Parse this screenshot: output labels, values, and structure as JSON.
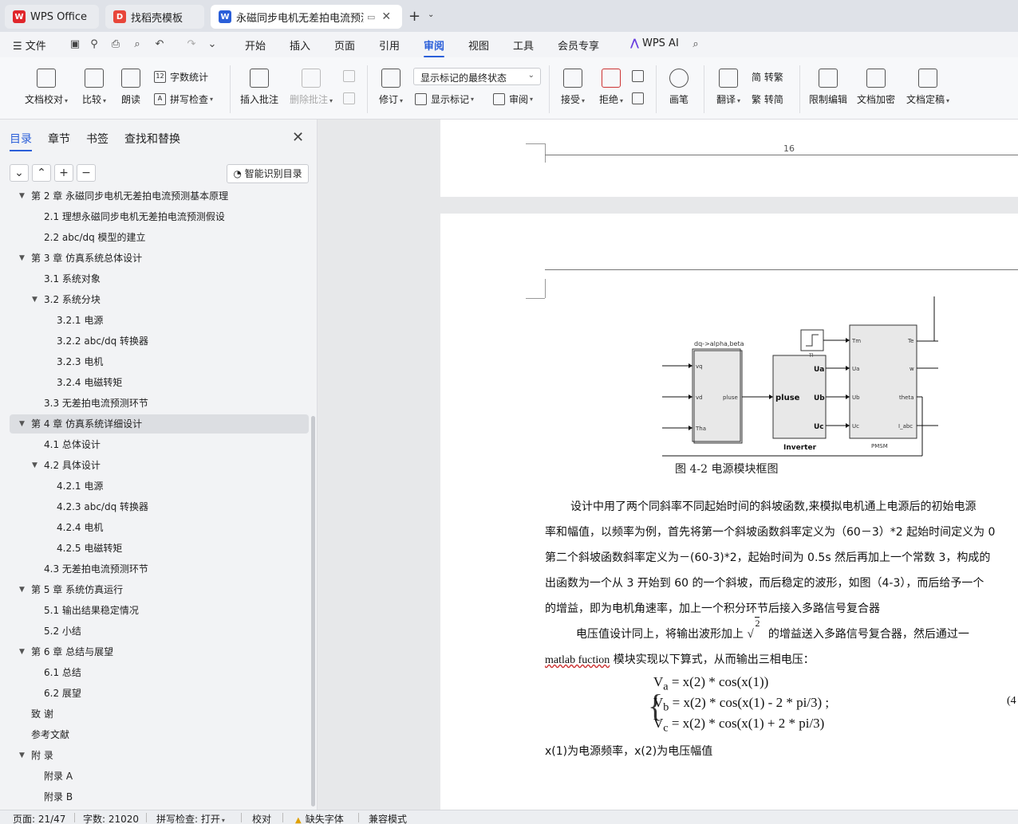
{
  "tabs": [
    {
      "label": "WPS Office",
      "icon": "wps-logo-icon"
    },
    {
      "label": "找稻壳模板",
      "icon": "docer-icon"
    },
    {
      "label": "永磁同步电机无差拍电流预测",
      "icon": "writer-doc-icon"
    }
  ],
  "menu": {
    "file": "文件",
    "items": [
      "开始",
      "插入",
      "页面",
      "引用",
      "审阅",
      "视图",
      "工具",
      "会员专享"
    ],
    "active": "审阅",
    "ai": "WPS AI"
  },
  "ribbon": {
    "doc_check": "文档校对",
    "compare": "比较",
    "read_aloud": "朗读",
    "word_count": "字数统计",
    "spell_check": "拼写检查",
    "insert_comment": "插入批注",
    "delete_comment": "删除批注",
    "track_changes": "修订",
    "markup_mode": "显示标记的最终状态",
    "show_markup": "显示标记",
    "review_pane": "审阅",
    "accept": "接受",
    "reject": "拒绝",
    "pen": "画笔",
    "translate": "翻译",
    "to_traditional": "简 转繁",
    "to_simplified": "繁 转简",
    "restrict_edit": "限制编辑",
    "encrypt": "文档加密",
    "finalize": "文档定稿"
  },
  "sidebar": {
    "tabs": [
      "目录",
      "章节",
      "书签",
      "查找和替换"
    ],
    "active_tab": "目录",
    "smart_toc": "智能识别目录",
    "toc": [
      {
        "text": "第 2 章  永磁同步电机无差拍电流预测基本原理",
        "level": 1,
        "toggle": "▼"
      },
      {
        "text": "2.1 理想永磁同步电机无差拍电流预测假设",
        "level": 2,
        "toggle": ""
      },
      {
        "text": "2.2 abc/dq 模型的建立",
        "level": 2,
        "toggle": ""
      },
      {
        "text": "第 3 章  仿真系统总体设计",
        "level": 1,
        "toggle": "▼"
      },
      {
        "text": "3.1 系统对象",
        "level": 2,
        "toggle": ""
      },
      {
        "text": "3.2 系统分块",
        "level": 2,
        "toggle": "▼"
      },
      {
        "text": "3.2.1 电源",
        "level": 3,
        "toggle": ""
      },
      {
        "text": "3.2.2 abc/dq 转换器",
        "level": 3,
        "toggle": ""
      },
      {
        "text": "3.2.3 电机",
        "level": 3,
        "toggle": ""
      },
      {
        "text": "3.2.4 电磁转矩",
        "level": 3,
        "toggle": ""
      },
      {
        "text": "3.3 无差拍电流预测环节",
        "level": 2,
        "toggle": ""
      },
      {
        "text": "第 4 章  仿真系统详细设计",
        "level": 1,
        "toggle": "▼",
        "selected": true
      },
      {
        "text": "4.1 总体设计",
        "level": 2,
        "toggle": ""
      },
      {
        "text": "4.2 具体设计",
        "level": 2,
        "toggle": "▼"
      },
      {
        "text": "4.2.1 电源",
        "level": 3,
        "toggle": ""
      },
      {
        "text": "4.2.3 abc/dq 转换器",
        "level": 3,
        "toggle": ""
      },
      {
        "text": "4.2.4 电机",
        "level": 3,
        "toggle": ""
      },
      {
        "text": "4.2.5 电磁转矩",
        "level": 3,
        "toggle": ""
      },
      {
        "text": "4.3 无差拍电流预测环节",
        "level": 2,
        "toggle": ""
      },
      {
        "text": "第 5 章  系统仿真运行",
        "level": 1,
        "toggle": "▼"
      },
      {
        "text": "5.1 输出结果稳定情况",
        "level": 2,
        "toggle": ""
      },
      {
        "text": "5.2 小结",
        "level": 2,
        "toggle": ""
      },
      {
        "text": "第 6 章  总结与展望",
        "level": 1,
        "toggle": "▼"
      },
      {
        "text": "6.1 总结",
        "level": 2,
        "toggle": ""
      },
      {
        "text": "6.2 展望",
        "level": 2,
        "toggle": ""
      },
      {
        "text": "致    谢",
        "level": 1,
        "toggle": ""
      },
      {
        "text": "参考文献",
        "level": 1,
        "toggle": ""
      },
      {
        "text": "附    录",
        "level": 1,
        "toggle": "▼"
      },
      {
        "text": "附录 A",
        "level": 2,
        "toggle": ""
      },
      {
        "text": "附录 B",
        "level": 2,
        "toggle": ""
      }
    ]
  },
  "document": {
    "page_number": "16",
    "diagram": {
      "block1_title": "dq->alpha,beta",
      "block1_in": [
        "vq",
        "vd",
        "Tha"
      ],
      "block1_out": "pluse",
      "inverter_in": "pluse",
      "inverter_out": [
        "Ua",
        "Ub",
        "Uc"
      ],
      "inverter_label": "Inverter",
      "tl_label": "Tl",
      "pmsm_in": [
        "Tm",
        "Ua",
        "Ub",
        "Uc"
      ],
      "pmsm_out": [
        "Te",
        "w",
        "theta",
        "I_abc"
      ],
      "pmsm_label": "PMSM"
    },
    "figure_caption": "图 4-2    电源模块框图",
    "paragraphs": [
      "设计中用了两个同斜率不同起始时间的斜坡函数,来模拟电机通上电源后的初始电源",
      "率和幅值，以频率为例，首先将第一个斜坡函数斜率定义为（60－3）*2 起始时间定义为 0",
      "第二个斜坡函数斜率定义为－(60-3)*2，起始时间为 0.5s 然后再加上一个常数 3，构成的",
      "出函数为一个从 3 开始到 60 的一个斜坡，而后稳定的波形，如图（4-3），而后给予一个",
      "的增益，即为电机角速率，加上一个积分环节后接入多路信号复合器"
    ],
    "para2_a": "电压值设计同上，将输出波形加上",
    "para2_sqrt": "2",
    "para2_b": "的增益送入多路信号复合器，然后通过一",
    "para3_matlab": "matlab fuction",
    "para3_rest": "模块实现以下算式，从而输出三相电压：",
    "eq": [
      "V<sub>a</sub> = x(2) * cos(x(1))",
      "V<sub>b</sub> = x(2) * cos(x(1) - 2 * pi/3) ;",
      "V<sub>c</sub> = x(2) * cos(x(1) + 2 * pi/3)"
    ],
    "eq_number": "(4",
    "last_line": "x(1)为电源频率，x(2)为电压幅值"
  },
  "status": {
    "page": "页面: 21/47",
    "words": "字数: 21020",
    "spell": "拼写检查: 打开",
    "proof": "校对",
    "missing_font": "缺失字体",
    "compat": "兼容模式"
  }
}
